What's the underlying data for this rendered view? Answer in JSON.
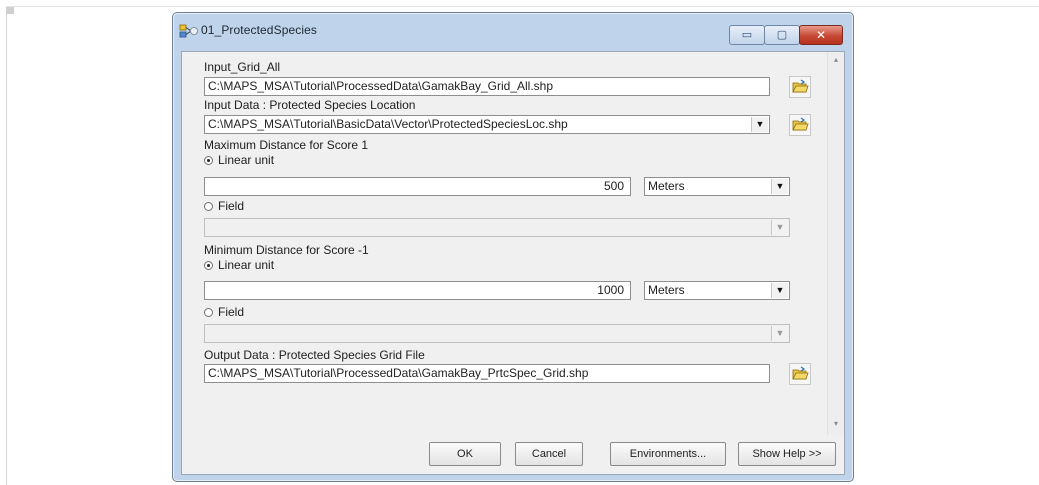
{
  "window": {
    "title": "01_ProtectedSpecies"
  },
  "titlebar_buttons": {
    "minimize_glyph": "▭",
    "maximize_glyph": "▢",
    "close_glyph": "✕"
  },
  "form": {
    "input_grid": {
      "label": "Input_Grid_All",
      "value": "C:\\MAPS_MSA\\Tutorial\\ProcessedData\\GamakBay_Grid_All.shp"
    },
    "input_data": {
      "label": "Input Data : Protected Species Location",
      "value": "C:\\MAPS_MSA\\Tutorial\\BasicData\\Vector\\ProtectedSpeciesLoc.shp"
    },
    "max_distance": {
      "label": "Maximum Distance for Score 1",
      "linear_unit_label": "Linear unit",
      "linear_unit_selected": true,
      "value": "500",
      "unit": "Meters",
      "field_label": "Field",
      "field_selected": false,
      "field_value": ""
    },
    "min_distance": {
      "label": "Minimum Distance for Score -1",
      "linear_unit_label": "Linear unit",
      "linear_unit_selected": true,
      "value": "1000",
      "unit": "Meters",
      "field_label": "Field",
      "field_selected": false,
      "field_value": ""
    },
    "output_data": {
      "label": "Output Data : Protected Species Grid File",
      "value": "C:\\MAPS_MSA\\Tutorial\\ProcessedData\\GamakBay_PrtcSpec_Grid.shp"
    }
  },
  "buttons": {
    "ok": "OK",
    "cancel": "Cancel",
    "environments": "Environments...",
    "show_help": "Show Help >>"
  },
  "colors": {
    "title_bar": "#bfd3ea",
    "close_button": "#c64a35",
    "dialog_bg": "#f0f0f0"
  }
}
